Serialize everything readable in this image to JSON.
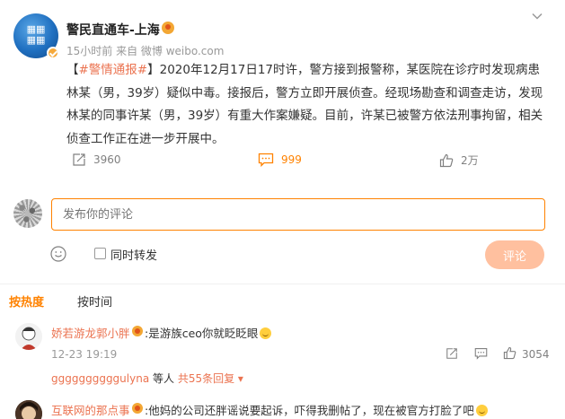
{
  "post": {
    "author": "警民直通车-上海",
    "meta": "15小时前 来自 微博 weibo.com",
    "tag": "#警情通报#",
    "text_open": "【",
    "text_after_tag": "】2020年12月17日17时许，警方接到报警称，某医院在诊疗时发现病患林某（男，39岁）疑似中毒。接报后，警方立即开展侦查。经现场勘查和调查走访，发现林某的同事许某（男，39岁）有重大作案嫌疑。目前，许某已被警方依法刑事拘留，相关侦查工作正在进一步开展中。",
    "repost_count": "3960",
    "comment_count": "999",
    "like_count": "2万"
  },
  "composer": {
    "placeholder": "发布你的评论",
    "repost_label": "同时转发",
    "submit_label": "评论"
  },
  "sort": {
    "hot_label": "按热度",
    "time_label": "按时间"
  },
  "comments": [
    {
      "user": "娇若游龙郭小胖",
      "text": ":是游族ceo你就眨眨眼",
      "time": "12-23 19:19",
      "like_count": "3054",
      "reply_user": "ggggggggggulyna",
      "reply_mid": " 等人 ",
      "reply_more": "共55条回复 ▾"
    },
    {
      "user": "互联网的那点事",
      "text": ":他妈的公司还胖谣说要起诉，吓得我删帖了，现在被官方打脸了吧"
    }
  ],
  "colors": {
    "accent": "#ff8200",
    "link": "#eb7350",
    "submit_disabled": "#ffc09f"
  }
}
